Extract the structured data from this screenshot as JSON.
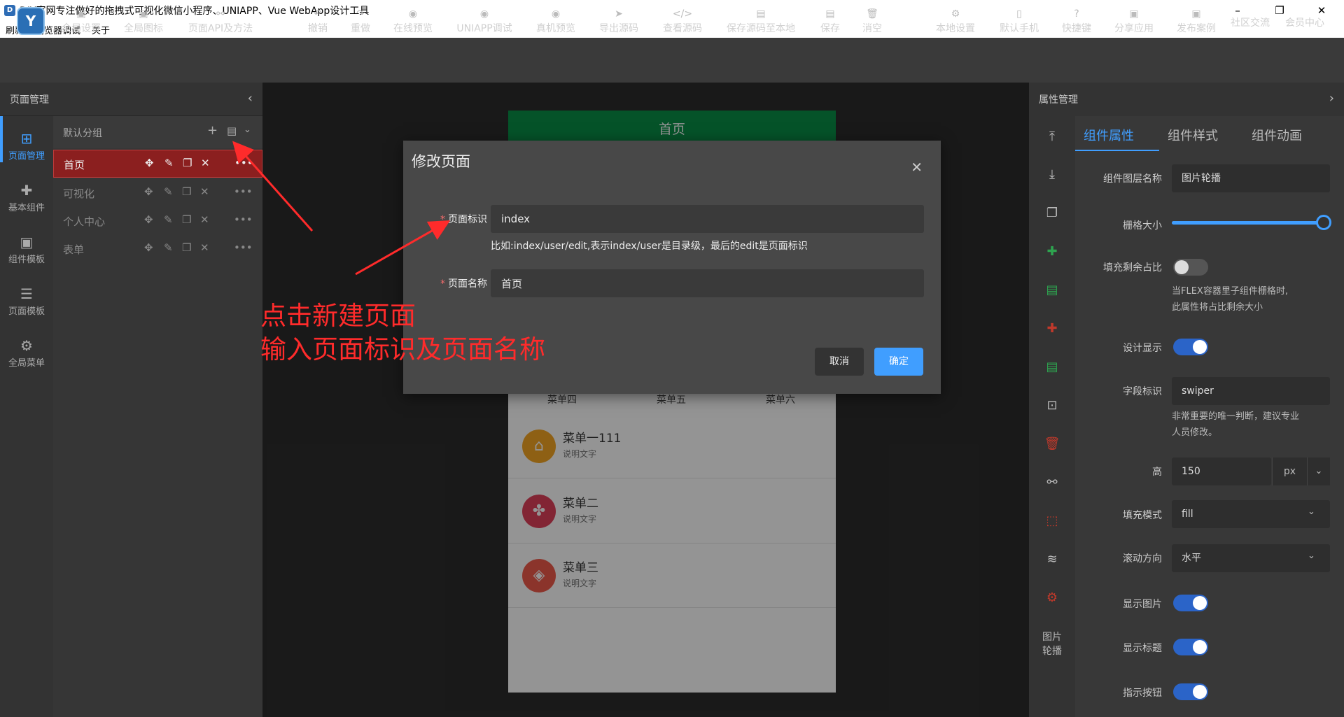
{
  "window": {
    "title": "DIY官网专注做好的拖拽式可视化微信小程序、UNIAPP、Vue WebApp设计工具",
    "controls": {
      "minimize": "–",
      "restore": "❐",
      "close": "✕"
    }
  },
  "menubar": [
    "刷新",
    "浏览器调试",
    "关于"
  ],
  "toolbar": {
    "global_settings": "全局设置",
    "global_icons": "全局图标",
    "page_api": "页面API及方法",
    "undo": "撤销",
    "redo": "重做",
    "online_preview": "在线预览",
    "uniapp_debug": "UNIAPP调试",
    "device_preview": "真机预览",
    "export_source": "导出源码",
    "view_source": "查看源码",
    "save_local": "保存源码至本地",
    "save": "保存",
    "clear": "消空",
    "local_settings": "本地设置",
    "default_phone": "默认手机",
    "shortcuts": "快捷键",
    "share_app": "分享应用",
    "publish_case": "发布案例",
    "community": "社区交流",
    "member_center": "会员中心"
  },
  "left_panel": {
    "title": "页面管理",
    "rail": [
      "页面管理",
      "基本组件",
      "组件模板",
      "页面模板",
      "全局菜单"
    ],
    "group": "默认分组",
    "pages": [
      "首页",
      "可视化",
      "个人中心",
      "表单"
    ]
  },
  "phone": {
    "header": "首页",
    "nav_labels": [
      "菜单四",
      "菜单五",
      "菜单六"
    ],
    "menu_items": [
      {
        "title": "菜单一111",
        "subtitle": "说明文字",
        "color": "#f5a623"
      },
      {
        "title": "菜单二",
        "subtitle": "说明文字",
        "color": "#e0405a"
      },
      {
        "title": "菜单三",
        "subtitle": "说明文字",
        "color": "#ef5b4b"
      }
    ]
  },
  "dialog": {
    "title": "修改页面",
    "page_id_label": "页面标识",
    "page_id_value": "index",
    "hint": "比如:index/user/edit,表示index/user是目录级，最后的edit是页面标识",
    "page_name_label": "页面名称",
    "page_name_value": "首页",
    "cancel": "取消",
    "confirm": "确定"
  },
  "annotation": {
    "line1": "点击新建页面",
    "line2": "输入页面标识及页面名称",
    "color": "#ff2b2b"
  },
  "right_panel": {
    "title": "属性管理",
    "tabs": [
      "组件属性",
      "组件样式",
      "组件动画"
    ],
    "rail_caption": "图片\n轮播",
    "layer_name_label": "组件图层名称",
    "layer_name_value": "图片轮播",
    "grid_label": "栅格大小",
    "grid_value": 1.0,
    "fill_label": "填充剩余占比",
    "fill_note_1": "当FLEX容器里子组件栅格时,",
    "fill_note_2": "此属性将占比剩余大小",
    "design_show_label": "设计显示",
    "field_id_label": "字段标识",
    "field_id_value": "swiper",
    "field_note_1": "非常重要的唯一判断，建议专业",
    "field_note_2": "人员修改。",
    "height_label": "高",
    "height_value": "150",
    "height_unit": "px",
    "fill_mode_label": "填充模式",
    "fill_mode_value": "fill",
    "scroll_dir_label": "滚动方向",
    "scroll_dir_value": "水平",
    "show_image_label": "显示图片",
    "show_title_label": "显示标题",
    "indicator_label": "指示按钮",
    "toggles": {
      "fill": false,
      "design_show": true,
      "show_image": true,
      "show_title": true,
      "indicator": true
    }
  },
  "colors": {
    "accent": "#409eff",
    "danger": "#f56c6c",
    "header_green": "#0a8f47"
  }
}
